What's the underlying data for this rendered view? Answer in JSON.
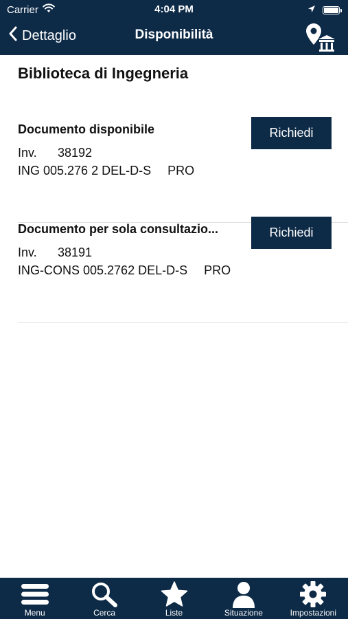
{
  "status_bar": {
    "carrier": "Carrier",
    "time": "4:04 PM"
  },
  "nav": {
    "back_label": "Dettaglio",
    "title": "Disponibilità",
    "action_icon": "library-location-icon"
  },
  "library": {
    "name": "Biblioteca di Ingegneria"
  },
  "items": [
    {
      "status": "Documento disponibile",
      "inv_label": "Inv.",
      "inv_number": "38192",
      "shelfmark": "ING 005.276 2 DEL-D-S",
      "collection": "PRO",
      "button_label": "Richiedi"
    },
    {
      "status": "Documento per sola consultazio...",
      "inv_label": "Inv.",
      "inv_number": "38191",
      "shelfmark": "ING-CONS 005.2762 DEL-D-S",
      "collection": "PRO",
      "button_label": "Richiedi"
    }
  ],
  "tabbar": {
    "tabs": [
      {
        "label": "Menu",
        "icon": "menu-icon"
      },
      {
        "label": "Cerca",
        "icon": "search-icon"
      },
      {
        "label": "Liste",
        "icon": "star-icon"
      },
      {
        "label": "Situazione",
        "icon": "user-icon"
      },
      {
        "label": "Impostazioni",
        "icon": "gear-icon"
      }
    ]
  },
  "colors": {
    "primary": "#0d2a47",
    "background": "#ffffff",
    "text": "#111111",
    "divider": "#e2e2e2"
  }
}
